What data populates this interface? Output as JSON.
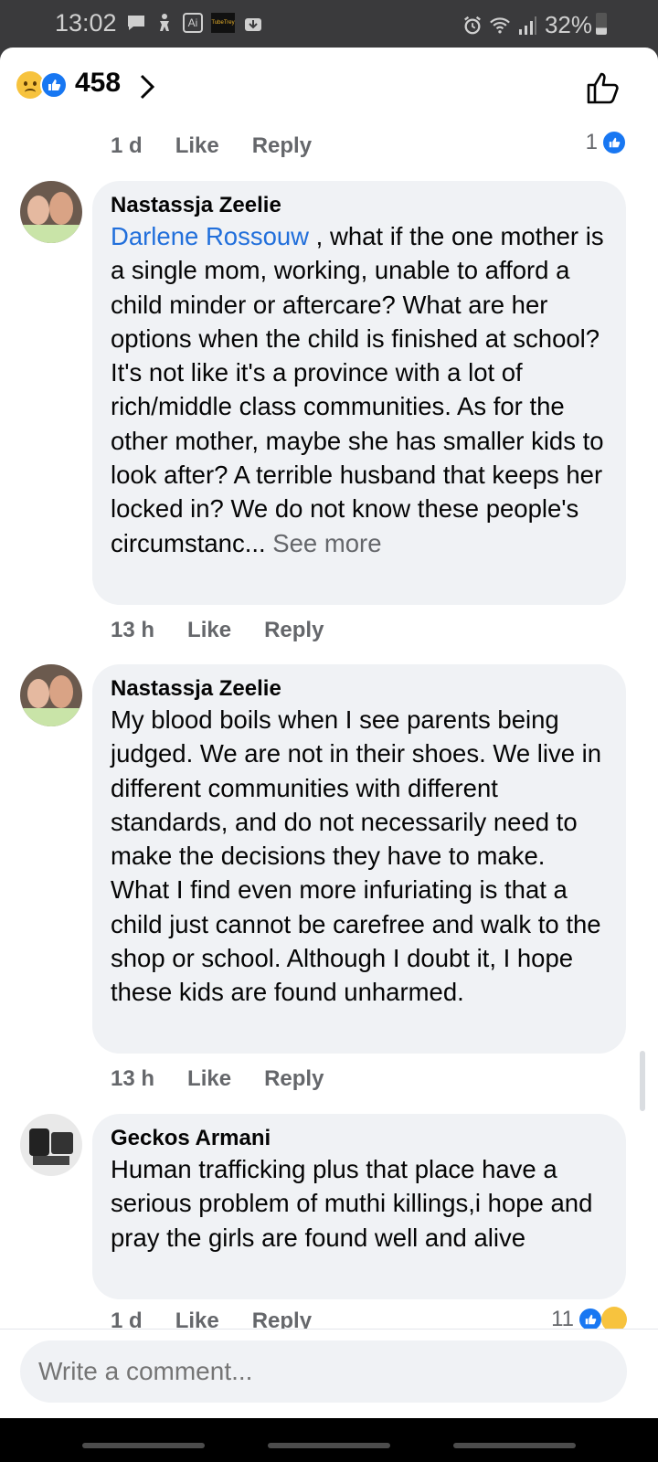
{
  "status_bar": {
    "time": "13:02",
    "ai_badge": "Ai",
    "tv_badge": "TubeTrey",
    "battery": "32%"
  },
  "header": {
    "reaction_count": "458"
  },
  "top_meta": {
    "time": "1 d",
    "like": "Like",
    "reply": "Reply",
    "like_count": "1"
  },
  "comments": [
    {
      "author": "Nastassja Zeelie",
      "mention": "Darlene Rossouw",
      "text": " , what if the one mother is a single mom, working, unable to afford a child minder or aftercare? What are her options when the child is finished at school? It's not like it's a province with a lot of rich/middle class communities. As for the other mother, maybe she has smaller kids to look after? A terrible husband that keeps her locked in? We do not know these people's circumstanc...",
      "see_more": " See more",
      "time": "13 h",
      "like": "Like",
      "reply": "Reply"
    },
    {
      "author": "Nastassja Zeelie",
      "text": "My blood boils when I see parents being judged. We are not in their shoes. We live in different communities with different standards, and do not necessarily need to make the decisions they have to make. What I find even more infuriating is that a child just cannot be carefree and walk to the shop or school. Although I doubt it, I hope these kids are found unharmed.",
      "time": "13 h",
      "like": "Like",
      "reply": "Reply"
    },
    {
      "author": "Geckos Armani",
      "text": "Human trafficking plus that place have a serious problem of muthi killings,i hope and pray the girls are found well and alive",
      "time": "1 d",
      "like": "Like",
      "reply": "Reply",
      "like_count": "11"
    }
  ],
  "composer": {
    "placeholder": "Write a comment..."
  },
  "colors": {
    "accent": "#1877f2",
    "mention": "#216fdb",
    "bubble": "#f0f2f5",
    "meta_text": "#65676b"
  }
}
